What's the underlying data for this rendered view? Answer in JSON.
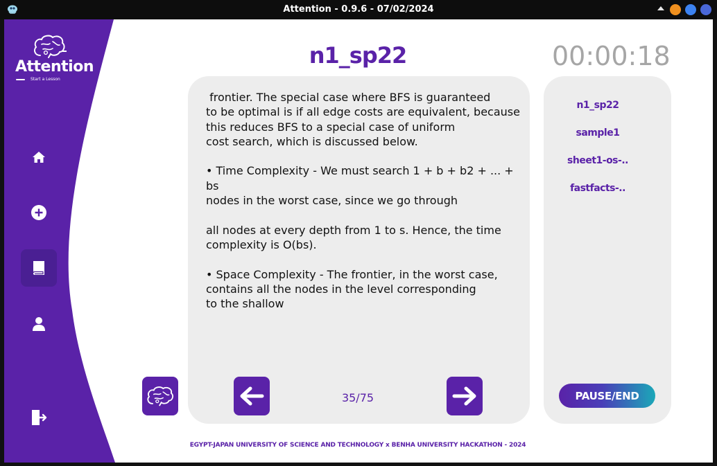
{
  "window": {
    "title": "Attention - 0.9.6 - 07/02/2024"
  },
  "brand": {
    "name": "Attention",
    "tagline": "Start a Lesson"
  },
  "sidebar": {
    "items": [
      {
        "icon": "home-icon",
        "active": false
      },
      {
        "icon": "add-circle-icon",
        "active": false
      },
      {
        "icon": "book-icon",
        "active": true
      },
      {
        "icon": "user-icon",
        "active": false
      },
      {
        "icon": "logout-icon",
        "active": false
      }
    ]
  },
  "lesson": {
    "title": "n1_sp22",
    "timer": "00:00:18",
    "content": " frontier. The special case where BFS is guaranteed\nto be optimal is if all edge costs are equivalent, because\nthis reduces BFS to a special case of uniform\ncost search, which is discussed below.\n\n• Time Complexity - We must search 1 + b + b2 + ... + bs\nnodes in the worst case, since we go through\n\nall nodes at every depth from 1 to s. Hence, the time\ncomplexity is O(bs).\n\n• Space Complexity - The frontier, in the worst case,\ncontains all the nodes in the level corresponding\nto the shallow",
    "page": "35/75"
  },
  "files": [
    "n1_sp22",
    "sample1",
    "sheet1-os-..",
    "fastfacts-.."
  ],
  "controls": {
    "pause_end_label": "PAUSE/END"
  },
  "footer": {
    "text": "EGYPT-JAPAN UNIVERSITY OF SCIENCE AND TECHNOLOGY x BENHA UNIVERSITY HACKATHON - 2024"
  },
  "colors": {
    "accent": "#5a22a8",
    "sidebar": "#5a22a8",
    "sidebar_active": "#4a1f93",
    "card": "#ededed",
    "timer": "#a6a6a6"
  }
}
